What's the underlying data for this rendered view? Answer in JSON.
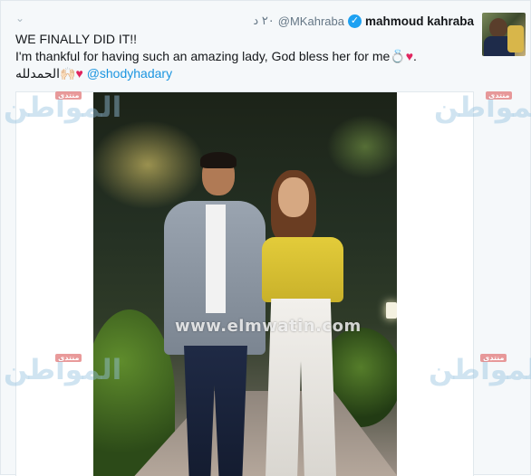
{
  "tweet": {
    "display_name": "mahmoud kahraba",
    "verified": true,
    "handle": "@MKahraba",
    "timestamp": "٢٠ د",
    "text_line1": "WE FINALLY DID IT!!",
    "text_line2": "I'm thankful for having such an amazing lady, God bless her for me",
    "text_line2_ring": "💍",
    "text_line2_heart": "♥",
    "text_line2_end": ".",
    "text_line3_mention": "@shodyhadary",
    "text_line3_heart": "♥",
    "text_line3_hands": "🙌🏻",
    "text_line3_arabic": "الحمدلله"
  },
  "icons": {
    "caret": "chevron-down-icon",
    "verified": "verified-badge-icon"
  },
  "watermarks": {
    "brand_text": "المواطن",
    "badge_text": "منتدى",
    "site_url": "www.elmwatin.com"
  },
  "colors": {
    "link": "#1b95e0",
    "verified": "#1da1f2",
    "heart": "#e0245e",
    "muted": "#657786"
  }
}
